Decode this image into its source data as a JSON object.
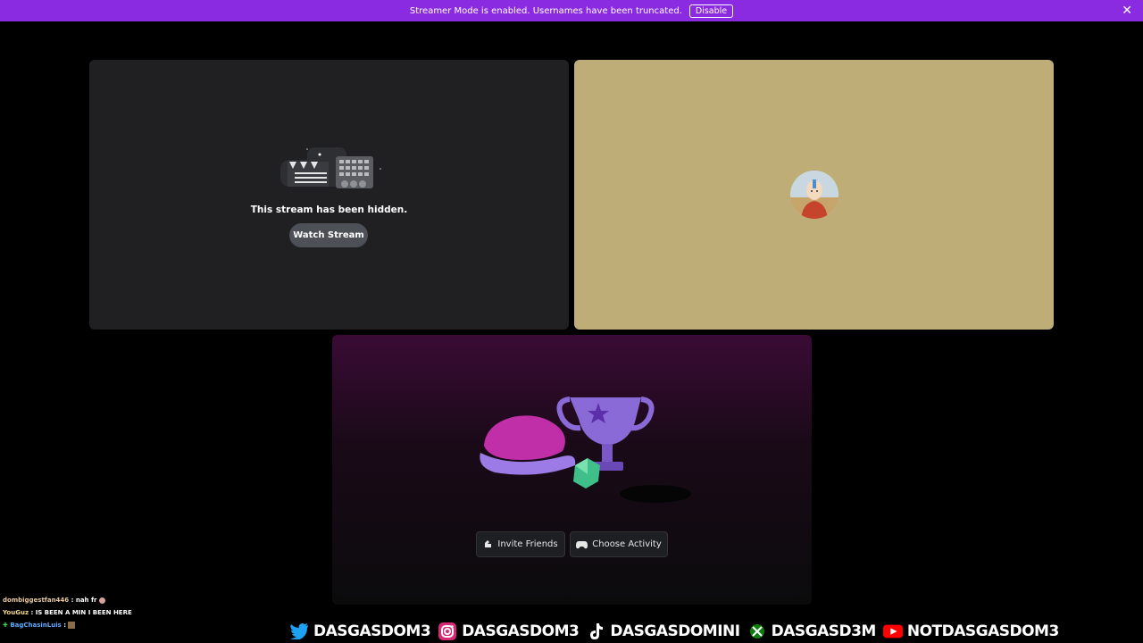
{
  "banner": {
    "message": "Streamer Mode is enabled. Usernames have been truncated.",
    "disable_label": "Disable",
    "close_symbol": "✕",
    "color": "#8a2be2"
  },
  "stream_tile": {
    "hidden_message": "This stream has been hidden.",
    "watch_label": "Watch Stream"
  },
  "activity_tile": {
    "invite_label": "Invite Friends",
    "choose_label": "Choose Activity"
  },
  "chat": [
    {
      "user": "dombiggestfan446",
      "text": " : nah fr "
    },
    {
      "user": "YouGuz",
      "text": " : IS BEEN A MIN I BEEN HERE"
    },
    {
      "user": "BagChasinLuis",
      "text": " : "
    }
  ],
  "socials": [
    {
      "icon": "twitter-icon",
      "handle": "DASGASDOM3"
    },
    {
      "icon": "instagram-icon",
      "handle": "DASGASDOM3"
    },
    {
      "icon": "tiktok-icon",
      "handle": "DASGASDOMINI"
    },
    {
      "icon": "xbox-icon",
      "handle": "DASGASD3M"
    },
    {
      "icon": "youtube-icon",
      "handle": "NOTDASGASDOM3"
    }
  ]
}
